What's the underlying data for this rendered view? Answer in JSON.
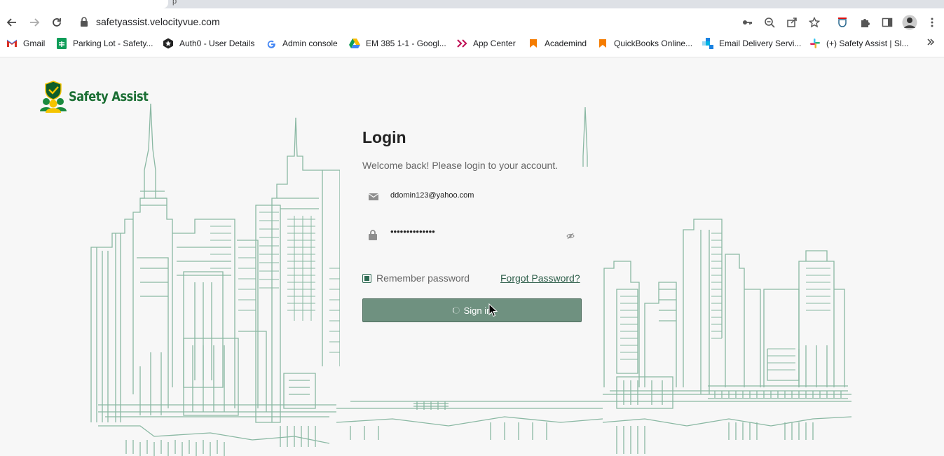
{
  "browser": {
    "url": "safetyassist.velocityvue.com",
    "tab_fragment": "p"
  },
  "bookmarks": [
    {
      "label": "Gmail"
    },
    {
      "label": "Parking Lot - Safety..."
    },
    {
      "label": "Auth0 - User Details"
    },
    {
      "label": "Admin console"
    },
    {
      "label": "EM 385 1-1 - Googl..."
    },
    {
      "label": "App Center"
    },
    {
      "label": "Academind"
    },
    {
      "label": "QuickBooks Online..."
    },
    {
      "label": "Email Delivery Servi..."
    },
    {
      "label": "(+) Safety Assist | Sl..."
    }
  ],
  "brand": {
    "name": "Safety Assist",
    "color": "#1a6e33"
  },
  "login": {
    "title": "Login",
    "subtitle": "Welcome back! Please login to your account.",
    "email_value": "ddomin123@yahoo.com",
    "password_masked": "••••••••••••••",
    "remember_label": "Remember password",
    "forgot_label": "Forgot Password?",
    "signin_label": "Sign in"
  },
  "colors": {
    "accent": "#6f9180",
    "line_art": "#8ab8a3"
  }
}
